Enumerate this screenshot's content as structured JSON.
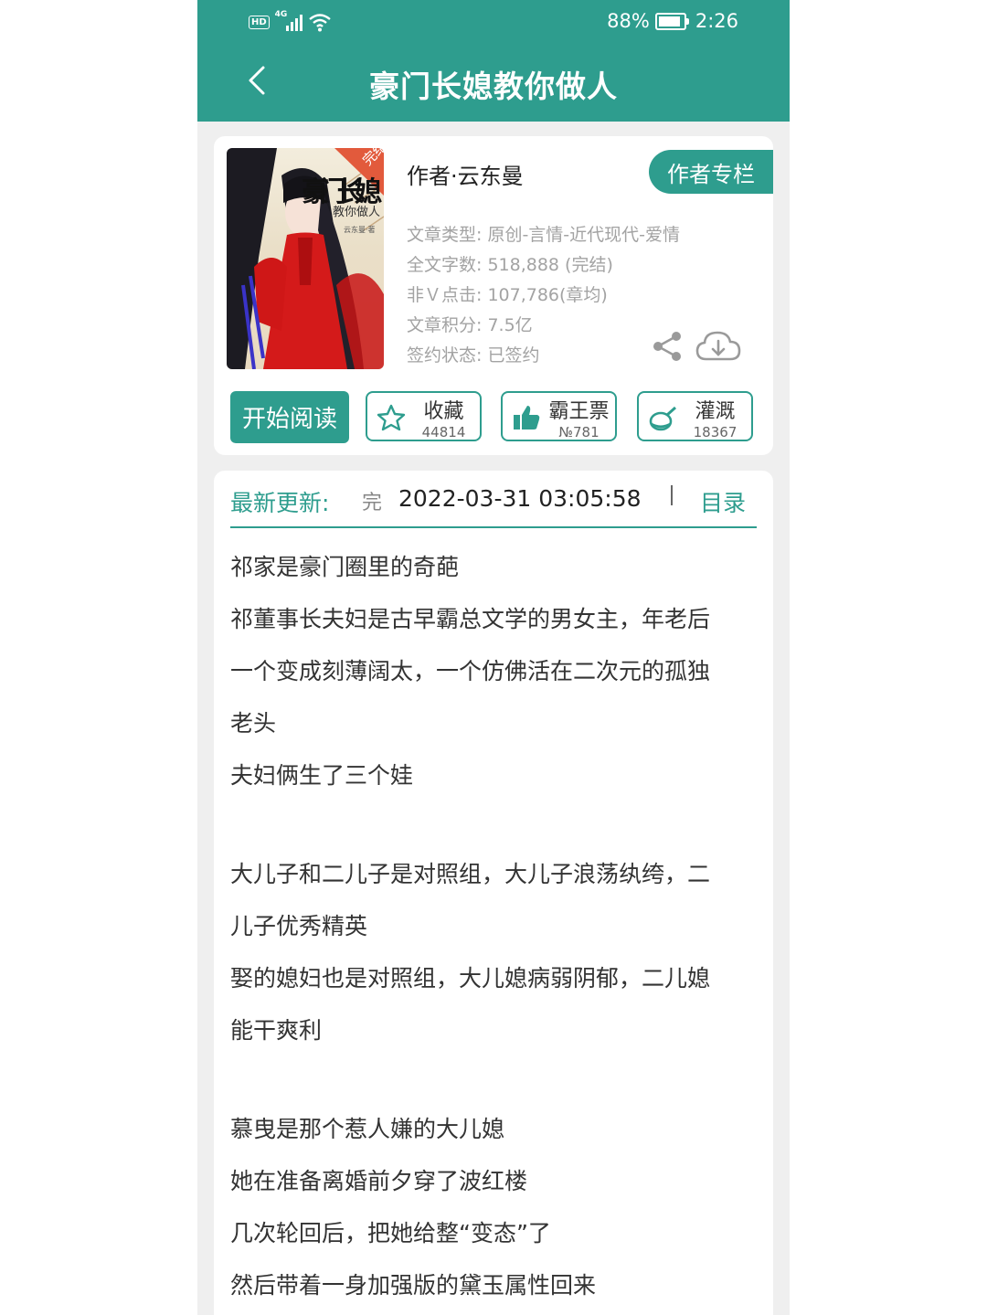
{
  "status_bar": {
    "left_badge": "HD",
    "signal_badge": "4G",
    "battery_text": "88%",
    "battery_level": 0.88,
    "time": "2:26"
  },
  "header": {
    "title": "豪门长媳教你做人",
    "back_icon": "chevron-left-icon"
  },
  "book": {
    "cover_title_1": "豪门长媳",
    "cover_title_2": "教你做人",
    "cover_author": "云东曼·著",
    "cover_badge": "完结",
    "author": "作者·云东曼",
    "author_column_button": "作者专栏",
    "meta": [
      "文章类型: 原创-言情-近代现代-爱情",
      "全文字数: 518,888 (完结)",
      "非Ｖ点击: 107,786(章均)",
      "文章积分: 7.5亿",
      "签约状态:  已签约"
    ],
    "icons": {
      "share": "share-icon",
      "download": "cloud-download-icon"
    }
  },
  "actions": {
    "read": "开始阅读",
    "favorite": {
      "label": "收藏",
      "count": "44814",
      "icon": "star-icon"
    },
    "vote": {
      "label": "霸王票",
      "count": "№781",
      "icon": "thumbs-up-icon"
    },
    "water": {
      "label": "灌溉",
      "count": "18367",
      "icon": "nutrient-bottle-icon"
    }
  },
  "update": {
    "label": "最新更新:",
    "status": "完",
    "datetime": "2022-03-31 03:05:58",
    "toc": "目录"
  },
  "synopsis": [
    "祁家是豪门圈里的奇葩",
    "祁董事长夫妇是古早霸总文学的男女主，年老后",
    "一个变成刻薄阔太，一个仿佛活在二次元的孤独",
    "老头",
    "夫妇俩生了三个娃",
    "大儿子和二儿子是对照组，大儿子浪荡纨绔，二",
    "儿子优秀精英",
    "娶的媳妇也是对照组，大儿媳病弱阴郁，二儿媳",
    "能干爽利",
    "慕曳是那个惹人嫌的大儿媳",
    "她在准备离婚前夕穿了波红楼",
    "几次轮回后，把她给整“变态”了",
    "然后带着一身加强版的黛玉属性回来"
  ],
  "colors": {
    "accent": "#2e9d8e",
    "background": "#efefef"
  }
}
